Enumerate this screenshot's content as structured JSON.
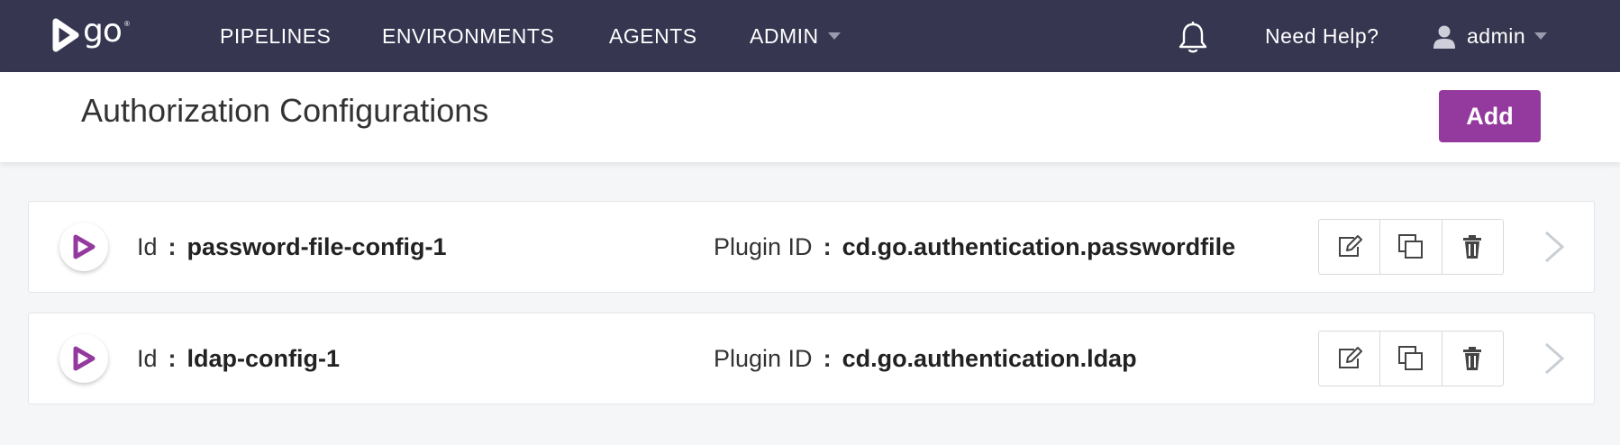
{
  "nav": {
    "logo": "go",
    "items": [
      {
        "label": "PIPELINES"
      },
      {
        "label": "ENVIRONMENTS"
      },
      {
        "label": "AGENTS"
      },
      {
        "label": "ADMIN"
      }
    ],
    "help_label": "Need Help?",
    "user_label": "admin",
    "icons": [
      "go-logo-icon",
      "bell-icon",
      "user-icon",
      "chevron-down-icon"
    ]
  },
  "header": {
    "title": "Authorization Configurations",
    "add_label": "Add"
  },
  "configs": [
    {
      "id_label": "Id",
      "id_value": "password-file-config-1",
      "plugin_label": "Plugin ID",
      "plugin_value": "cd.go.authentication.passwordfile"
    },
    {
      "id_label": "Id",
      "id_value": "ldap-config-1",
      "plugin_label": "Plugin ID",
      "plugin_value": "cd.go.authentication.ldap"
    }
  ],
  "row_icons": [
    "plugin-icon",
    "edit-icon",
    "clone-icon",
    "delete-icon",
    "chevron-right-icon"
  ],
  "colors": {
    "nav_bg": "#363651",
    "accent": "#943a9e",
    "page_bg": "#f4f6f7"
  }
}
